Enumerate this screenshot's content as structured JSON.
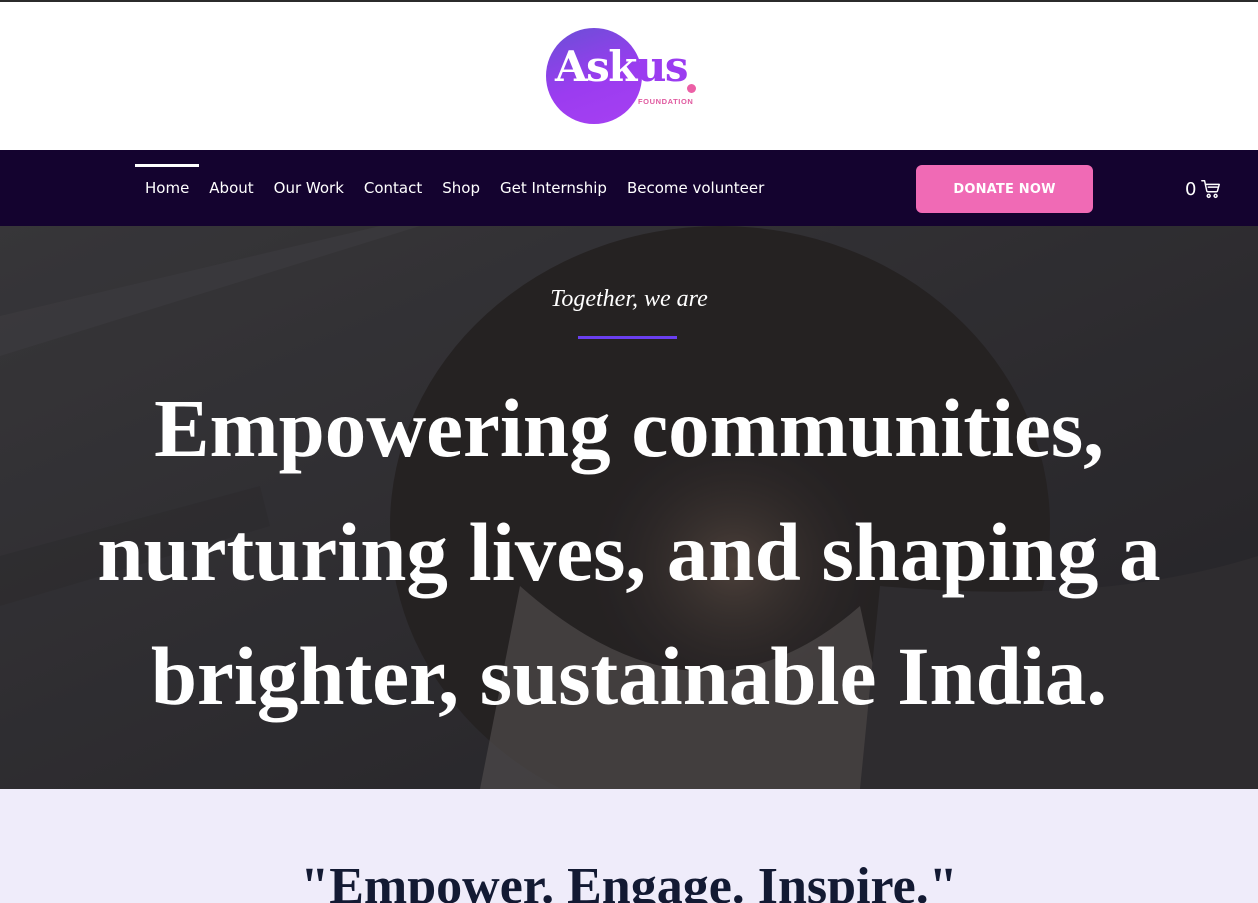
{
  "logo": {
    "word_main": "Ask",
    "word_tail": "us",
    "subtitle": "FOUNDATION",
    "icon": "askus-logo-icon"
  },
  "nav": {
    "items": [
      {
        "label": "Home",
        "active": true
      },
      {
        "label": "About"
      },
      {
        "label": "Our Work"
      },
      {
        "label": "Contact"
      },
      {
        "label": "Shop"
      },
      {
        "label": "Get Internship"
      },
      {
        "label": "Become volunteer"
      }
    ],
    "donate_label": "DONATE NOW",
    "cart_count": "0",
    "cart_icon": "cart-icon"
  },
  "hero": {
    "kicker": "Together, we are",
    "title": "Empowering communities, nurturing lives, and shaping a brighter, sustainable India."
  },
  "mission": {
    "title": "\"Empower. Engage. Inspire.\""
  },
  "colors": {
    "nav_bg": "#14032f",
    "donate_bg": "#f06ab5",
    "accent_purple": "#6a3ff0",
    "section_bg": "#efecfa"
  }
}
